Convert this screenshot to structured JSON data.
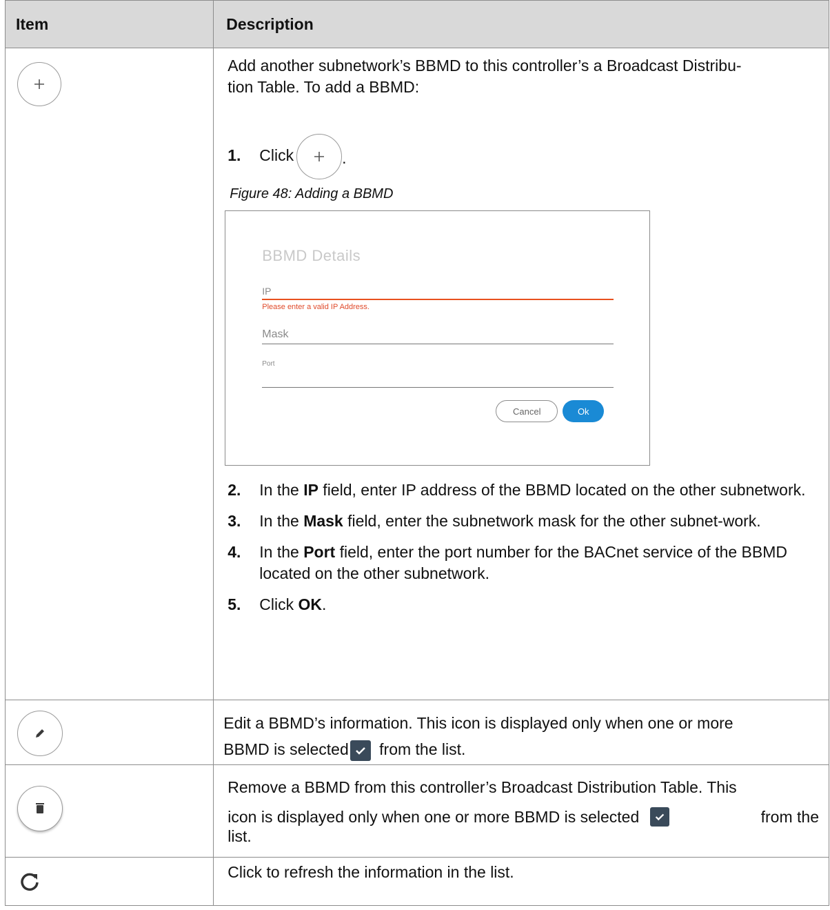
{
  "header": {
    "item": "Item",
    "description": "Description"
  },
  "rows": {
    "add": {
      "intro_line1": "Add another subnetwork’s BBMD to this controller’s a Broadcast Distribu-",
      "intro_line2": "tion Table. To add a BBMD:",
      "step1_num": "1.",
      "step1_text": "Click",
      "step1_end": ".",
      "figure_caption": "Figure 48: Adding a BBMD",
      "dialog": {
        "title": "BBMD Details",
        "ip_label": "IP",
        "ip_error": "Please enter a valid IP Address.",
        "mask_label": "Mask",
        "port_label": "Port",
        "cancel": "Cancel",
        "ok": "Ok"
      },
      "step2_num": "2.",
      "step2_pre": "In the ",
      "step2_bold": "IP",
      "step2_post": " field, enter IP address of the BBMD located on the other subnetwork.",
      "step3_num": "3.",
      "step3_pre": "In the ",
      "step3_bold": "Mask",
      "step3_post": " field, enter the subnetwork mask for the other subnet-work.",
      "step4_num": "4.",
      "step4_pre": "In the ",
      "step4_bold": "Port",
      "step4_post": " field, enter the port number for the BACnet service of the BBMD located on the other subnetwork.",
      "step5_num": "5.",
      "step5_pre": "Click ",
      "step5_bold": "OK",
      "step5_post": "."
    },
    "edit": {
      "line1": "Edit a BBMD’s information. This icon is displayed only when one or more",
      "line2_pre": "BBMD is selected",
      "line2_post": " from the list."
    },
    "remove": {
      "line1": "Remove a BBMD from this controller’s Broadcast Distribution Table. This",
      "line2_pre": "icon is displayed only when one or more BBMD is selected",
      "line2_post": "from the",
      "line3": "list."
    },
    "refresh": {
      "line1": "Click to refresh the information in the list."
    }
  },
  "icons": {
    "add": "plus-icon",
    "edit": "pencil-icon",
    "remove": "trash-icon",
    "refresh": "refresh-icon",
    "check": "checkbox-checked-icon"
  },
  "colors": {
    "header_bg": "#d9d9d9",
    "error": "#e8501e",
    "ok_button": "#1a8ad5",
    "checkbox": "#3a4a5a"
  }
}
